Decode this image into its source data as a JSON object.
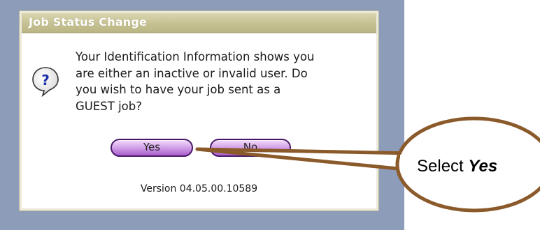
{
  "dialog": {
    "title": "Job Status Change",
    "message": "Your Identification Information shows you\nare either an inactive or invalid user. Do\nyou wish to have your job sent as a\nGUEST job?",
    "yes_label": "Yes",
    "no_label": "No",
    "version": "Version 04.05.00.10589",
    "icon": "question-icon"
  },
  "callout": {
    "prefix": "Select ",
    "emphasis": "Yes"
  },
  "colors": {
    "backdrop": "#8d9cb8",
    "titlebar": "#c6c193",
    "button": "#c98ae0",
    "callout_border": "#8b5a2b"
  }
}
